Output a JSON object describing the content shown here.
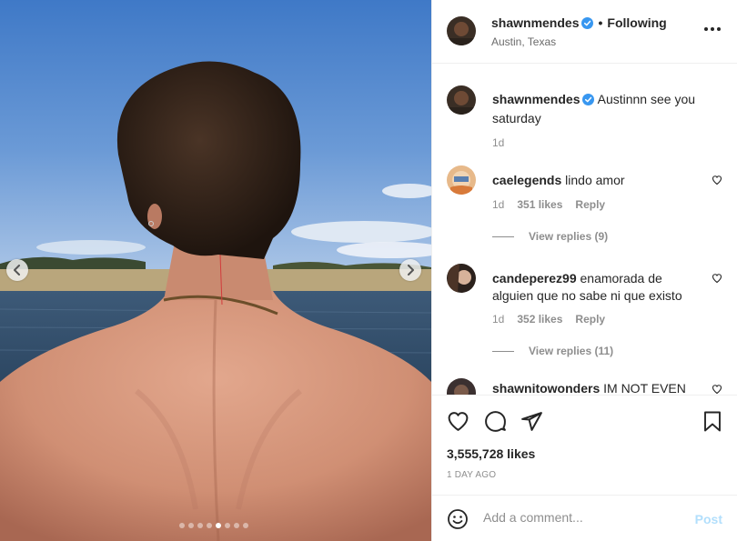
{
  "post": {
    "username": "shawnmendes",
    "location": "Austin, Texas",
    "follow_label": "Following",
    "dot_separator": "•",
    "caption_text": "Austinnn see you saturday",
    "caption_time": "1d",
    "likes": "3,555,728 likes",
    "time_ago": "1 DAY AGO",
    "carousel": {
      "count": 8,
      "active_index": 4
    }
  },
  "comments": [
    {
      "username": "caelegends",
      "text": "lindo amor",
      "time": "1d",
      "likes": "351 likes",
      "reply_label": "Reply",
      "view_replies": "View replies (9)"
    },
    {
      "username": "candeperez99",
      "text": "enamorada de alguien que no sabe ni que existo",
      "time": "1d",
      "likes": "352 likes",
      "reply_label": "Reply",
      "view_replies": "View replies (11)"
    },
    {
      "username": "shawnitowonders",
      "text": "IM NOT EVEN"
    }
  ],
  "composer": {
    "placeholder": "Add a comment...",
    "post_label": "Post"
  },
  "icons": {
    "verified": "verified-badge-icon",
    "more": "more-options-icon",
    "like": "heart-icon",
    "comment": "comment-icon",
    "share": "share-icon",
    "save": "bookmark-icon",
    "emoji": "emoji-icon",
    "prev": "chevron-left-icon",
    "next": "chevron-right-icon"
  },
  "colors": {
    "verified_blue": "#3897f0",
    "muted_text": "#8e8e8e",
    "post_button_disabled": "#b2dffc"
  }
}
